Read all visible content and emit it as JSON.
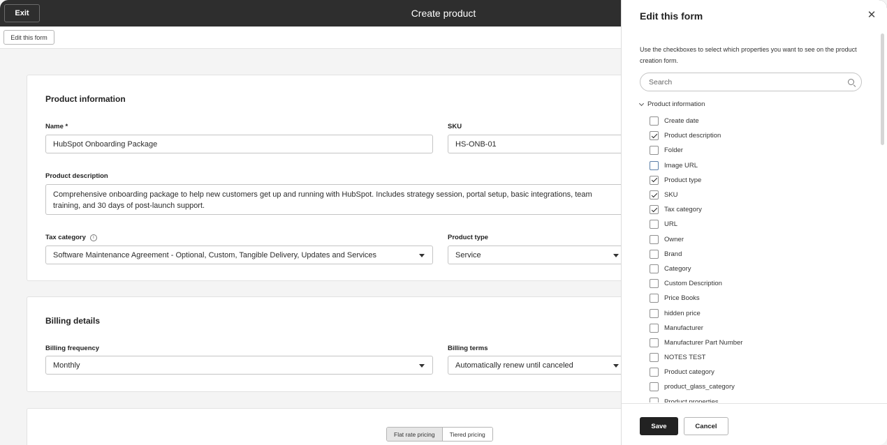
{
  "topbar": {
    "exit_label": "Exit",
    "title": "Create product"
  },
  "subbar": {
    "edit_form_label": "Edit this form"
  },
  "product_info": {
    "title": "Product information",
    "name_label": "Name *",
    "name_value": "HubSpot Onboarding Package",
    "sku_label": "SKU",
    "sku_value": "HS-ONB-01",
    "description_label": "Product description",
    "description_value": "Comprehensive onboarding package to help new customers get up and running with HubSpot. Includes strategy session, portal setup, basic integrations, team training, and 30 days of post-launch support.",
    "tax_label": "Tax category",
    "tax_info_icon": "i",
    "tax_value": "Software Maintenance Agreement - Optional, Custom, Tangible Delivery, Updates and Services",
    "type_label": "Product type",
    "type_value": "Service"
  },
  "billing": {
    "title": "Billing details",
    "frequency_label": "Billing frequency",
    "frequency_value": "Monthly",
    "terms_label": "Billing terms",
    "terms_value": "Automatically renew until canceled"
  },
  "pricing": {
    "flat_label": "Flat rate pricing",
    "tiered_label": "Tiered pricing"
  },
  "panel": {
    "title": "Edit this form",
    "close_glyph": "✕",
    "description": "Use the checkboxes to select which properties you want to see on the product creation form.",
    "search_placeholder": "Search",
    "group_label": "Product information",
    "items": [
      {
        "label": "Create date",
        "checked": false
      },
      {
        "label": "Product description",
        "checked": true
      },
      {
        "label": "Folder",
        "checked": false
      },
      {
        "label": "Image URL",
        "checked": false,
        "focus": true
      },
      {
        "label": "Product type",
        "checked": true
      },
      {
        "label": "SKU",
        "checked": true
      },
      {
        "label": "Tax category",
        "checked": true
      },
      {
        "label": "URL",
        "checked": false
      },
      {
        "label": "Owner",
        "checked": false
      },
      {
        "label": "Brand",
        "checked": false
      },
      {
        "label": "Category",
        "checked": false
      },
      {
        "label": "Custom Description",
        "checked": false
      },
      {
        "label": "Price Books",
        "checked": false
      },
      {
        "label": "hidden price",
        "checked": false
      },
      {
        "label": "Manufacturer",
        "checked": false
      },
      {
        "label": "Manufacturer Part Number",
        "checked": false
      },
      {
        "label": "NOTES TEST",
        "checked": false
      },
      {
        "label": "Product category",
        "checked": false
      },
      {
        "label": "product_glass_category",
        "checked": false
      },
      {
        "label": "Product properties",
        "checked": false
      }
    ],
    "save_label": "Save",
    "cancel_label": "Cancel"
  }
}
